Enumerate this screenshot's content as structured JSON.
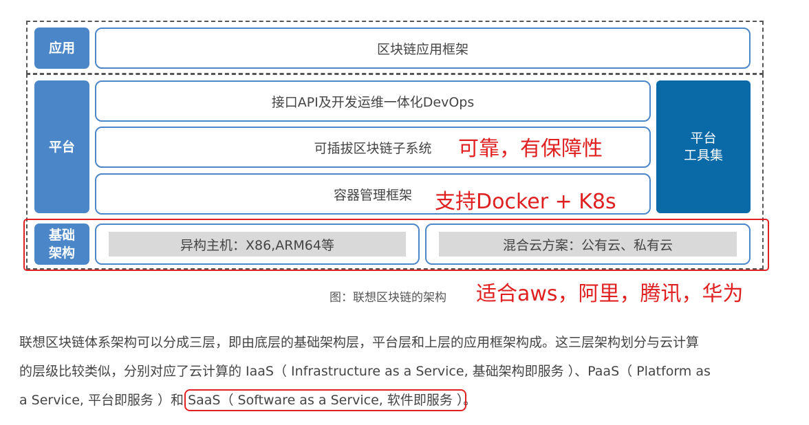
{
  "layers": {
    "app": {
      "label": "应用",
      "box": "区块链应用框架"
    },
    "platform": {
      "label": "平台",
      "boxes": [
        "接口API及开发运维一体化DevOps",
        "可插拔区块链子系统",
        "容器管理框架"
      ],
      "tool_lines": [
        "平台",
        "工具集"
      ]
    },
    "infra": {
      "label_lines": [
        "基础",
        "架构"
      ],
      "boxes": [
        "异构主机：X86,ARM64等",
        "混合云方案：公有云、私有云"
      ]
    }
  },
  "annotations": {
    "reliable": "可靠，有保障性",
    "docker": "支持Docker + K8s",
    "cloud": "适合aws，阿里，腾讯，华为"
  },
  "caption": "图：联想区块链的架构",
  "paragraph": {
    "line1": "联想区块链体系架构可以分成三层，即由底层的基础架构层，平台层和上层的应用框架构成。这三层架构划分与云计算",
    "line2": "的层级比较类似，分别对应了云计算的 IaaS（ Infrastructure as a Service, 基础架构即服务 ）、PaaS（ Platform as",
    "line3_before": "a Service, 平台即服务 ）和 ",
    "line3_highlight": "SaaS（ Software as a Service, 软件即服务 ）",
    "line3_after": "。"
  },
  "colors": {
    "side_blue": "#4a86c8",
    "tool_blue": "#0a6aa8",
    "annotation_red": "#e02020"
  }
}
